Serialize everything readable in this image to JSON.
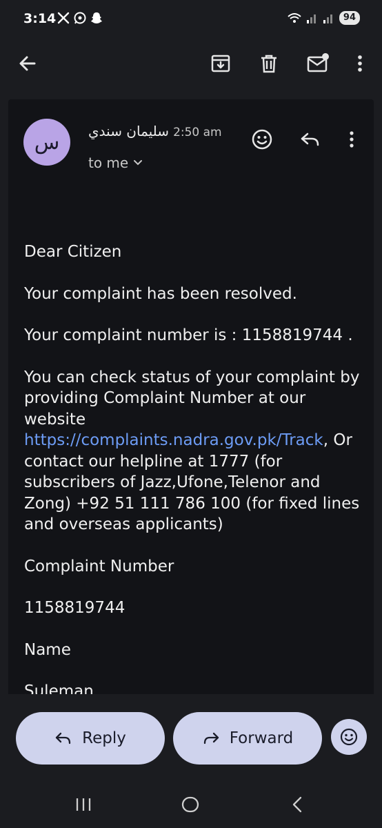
{
  "status_bar": {
    "time": "3:14",
    "battery": "94"
  },
  "app_bar": {
    "icons": [
      "back-arrow-icon",
      "archive-icon",
      "trash-icon",
      "mark-unread-icon",
      "more-vert-icon"
    ]
  },
  "message": {
    "avatar_letter": "س",
    "sender_name": "سليمان سندي",
    "sent_time": "2:50 am",
    "recipient": "to me",
    "body": {
      "greeting": "Dear Citizen",
      "line1": "Your complaint has been resolved.",
      "line2": "Your complaint number is : 1158819744 .",
      "para_start": "You can check status of your complaint by providing Complaint Number at our website ",
      "link": "https://complaints.nadra.gov.pk/Track",
      "para_end": ", Or contact our helpline at 1777 (for subscribers of Jazz,Ufone,Telenor and Zong) +92 51 111 786 100 (for fixed lines and overseas applicants)",
      "label_number": "Complaint Number",
      "value_number": "1158819744",
      "label_name": "Name",
      "value_name": "Suleman"
    }
  },
  "actions": {
    "reply_label": "Reply",
    "forward_label": "Forward"
  },
  "colors": {
    "background": "#1b1c20",
    "content_bg": "#121317",
    "pill_bg": "#cfd3ed",
    "avatar_bg": "#b9a4e6",
    "link": "#6d9cf5"
  }
}
